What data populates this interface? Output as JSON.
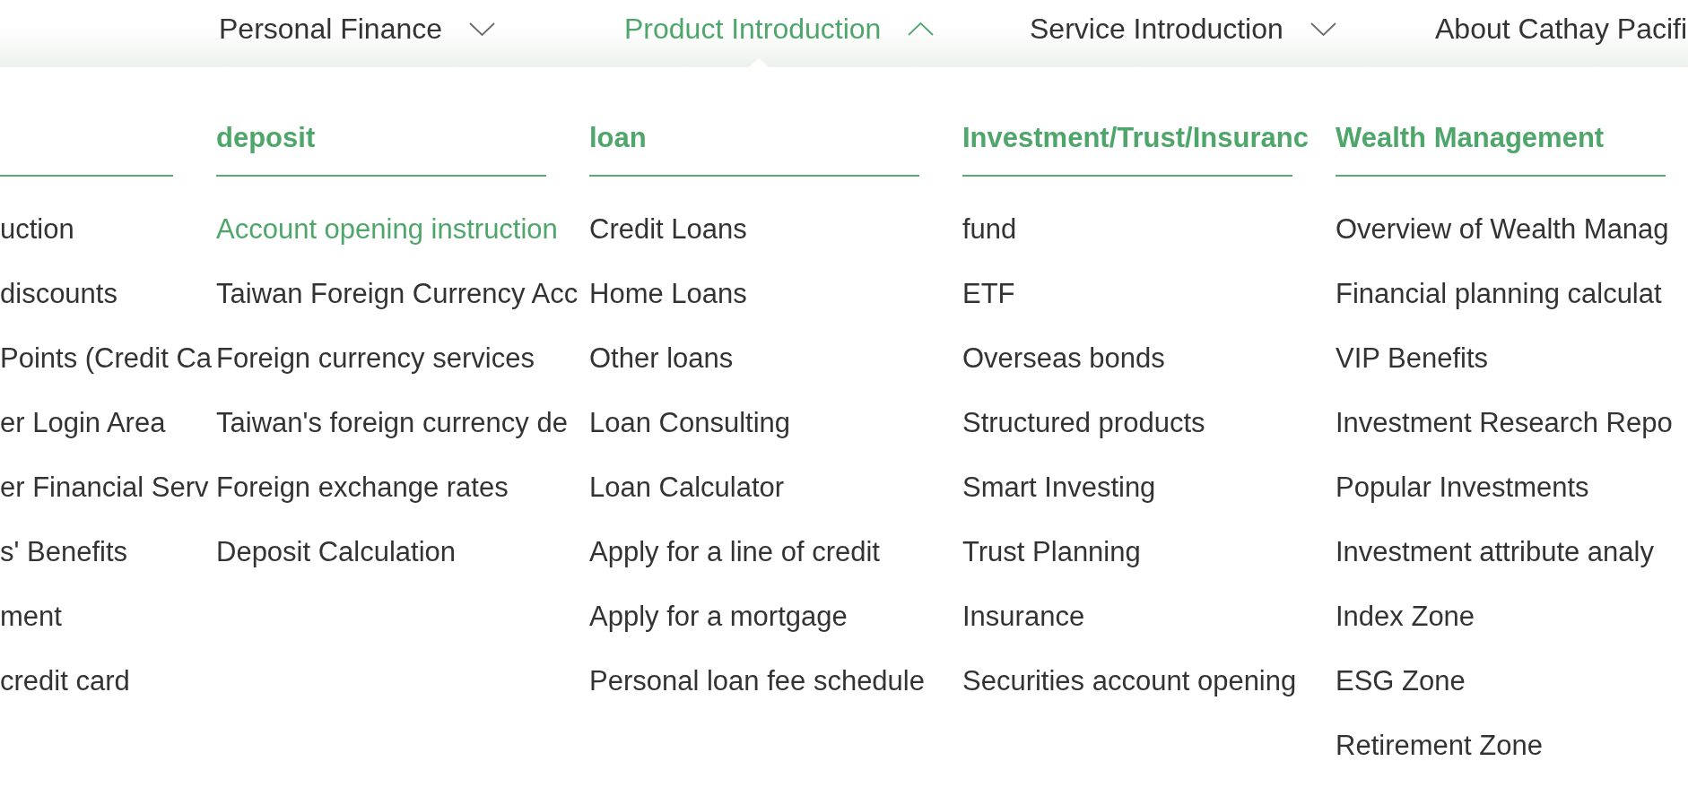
{
  "nav": [
    {
      "label": "Personal Finance",
      "selected": false,
      "expanded": false
    },
    {
      "label": "Product Introduction",
      "selected": true,
      "expanded": true
    },
    {
      "label": "Service Introduction",
      "selected": false,
      "expanded": false
    },
    {
      "label": "About Cathay Pacifi",
      "selected": false
    }
  ],
  "dropdown": {
    "columns": [
      {
        "items": [
          {
            "label": "uction",
            "selected": false
          },
          {
            "label": "discounts",
            "selected": false
          },
          {
            "label": "Points (Credit Ca",
            "selected": false
          },
          {
            "label": "er Login Area",
            "selected": false
          },
          {
            "label": "er Financial Serv",
            "selected": false
          },
          {
            "label": "s' Benefits",
            "selected": false
          },
          {
            "label": "ment",
            "selected": false
          },
          {
            "label": "credit card",
            "selected": false
          }
        ]
      },
      {
        "title": "deposit",
        "items": [
          {
            "label": "Account opening instruction",
            "selected": true
          },
          {
            "label": "Taiwan Foreign Currency Acc",
            "selected": false
          },
          {
            "label": "Foreign currency services",
            "selected": false
          },
          {
            "label": "Taiwan's foreign currency de",
            "selected": false
          },
          {
            "label": "Foreign exchange rates",
            "selected": false
          },
          {
            "label": "Deposit Calculation",
            "selected": false
          }
        ]
      },
      {
        "title": "loan",
        "items": [
          {
            "label": "Credit Loans",
            "selected": false
          },
          {
            "label": "Home Loans",
            "selected": false
          },
          {
            "label": "Other loans",
            "selected": false
          },
          {
            "label": "Loan Consulting",
            "selected": false
          },
          {
            "label": "Loan Calculator",
            "selected": false
          },
          {
            "label": "Apply for a line of credit",
            "selected": false
          },
          {
            "label": "Apply for a mortgage",
            "selected": false
          },
          {
            "label": "Personal loan fee schedule",
            "selected": false
          }
        ]
      },
      {
        "title": "Investment/Trust/Insuranc",
        "items": [
          {
            "label": "fund",
            "selected": false
          },
          {
            "label": "ETF",
            "selected": false
          },
          {
            "label": "Overseas bonds",
            "selected": false
          },
          {
            "label": "Structured products",
            "selected": false
          },
          {
            "label": "Smart Investing",
            "selected": false
          },
          {
            "label": "Trust Planning",
            "selected": false
          },
          {
            "label": "Insurance",
            "selected": false
          },
          {
            "label": "Securities account opening",
            "selected": false
          }
        ]
      },
      {
        "title": "Wealth Management",
        "items": [
          {
            "label": "Overview of Wealth Manag",
            "selected": false
          },
          {
            "label": "Financial planning calculat",
            "selected": false
          },
          {
            "label": "VIP Benefits",
            "selected": false
          },
          {
            "label": "Investment Research Repo",
            "selected": false
          },
          {
            "label": "Popular Investments",
            "selected": false
          },
          {
            "label": "Investment attribute analy",
            "selected": false
          },
          {
            "label": "Index Zone",
            "selected": false
          },
          {
            "label": "ESG Zone",
            "selected": false
          },
          {
            "label": "Retirement Zone",
            "selected": false
          }
        ]
      }
    ]
  }
}
